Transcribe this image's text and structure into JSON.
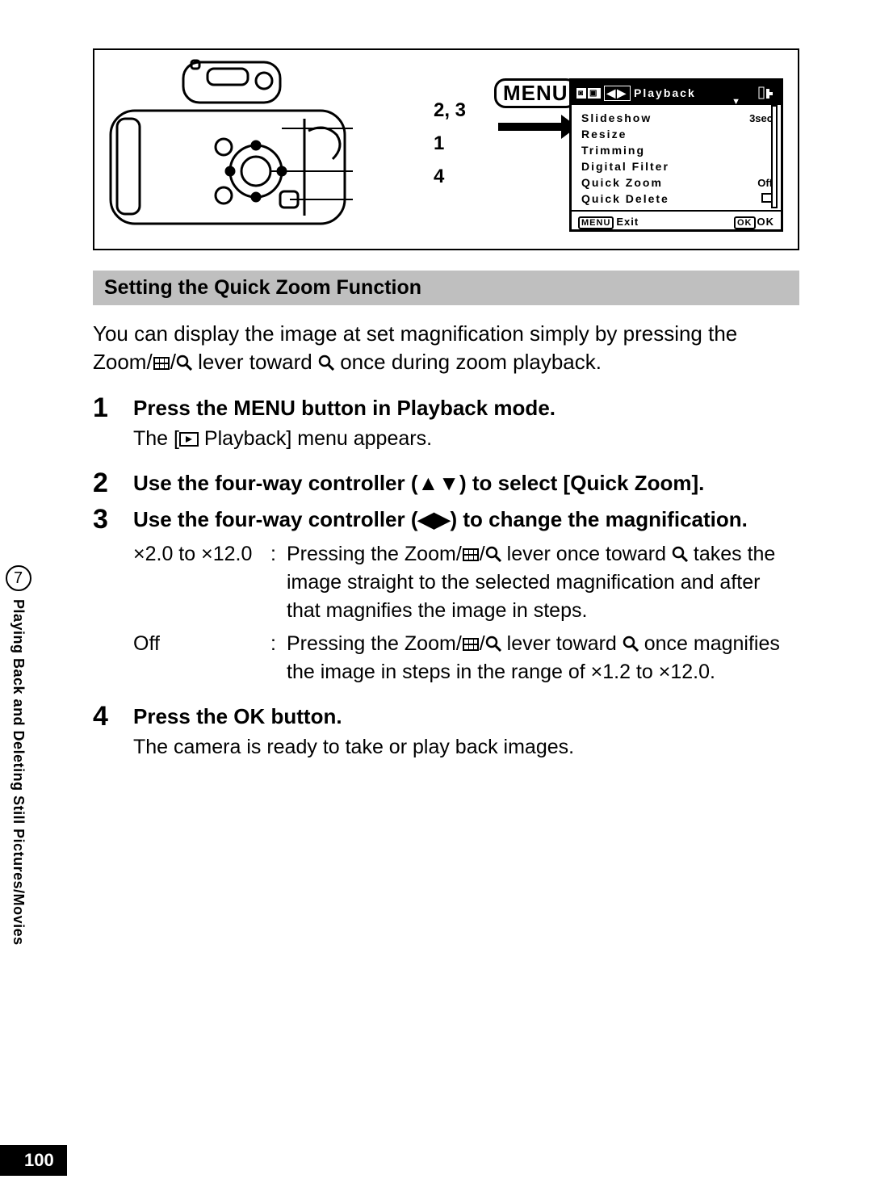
{
  "page_number": "100",
  "sidebar": {
    "chapter_num": "7",
    "chapter_title": "Playing Back and Deleting Still Pictures/Movies"
  },
  "figure": {
    "menu_button_label": "MENU",
    "callouts": {
      "line1": "2, 3",
      "line2": "1",
      "line3": "4"
    }
  },
  "lcd": {
    "title": "Playback",
    "items": [
      {
        "label": "Slideshow",
        "value": "3sec"
      },
      {
        "label": "Resize",
        "value": ""
      },
      {
        "label": "Trimming",
        "value": ""
      },
      {
        "label": "Digital Filter",
        "value": ""
      },
      {
        "label": "Quick Zoom",
        "value": "Off"
      },
      {
        "label": "Quick Delete",
        "value": "icon"
      }
    ],
    "footer_left_btn": "MENU",
    "footer_left": "Exit",
    "footer_right_btn": "OK",
    "footer_right": "OK"
  },
  "section_heading": "Setting the Quick Zoom Function",
  "intro_a": "You can display the image at set magnification simply by pressing the Zoom/",
  "intro_b": " lever toward ",
  "intro_c": " once during zoom playback.",
  "steps": {
    "s1": {
      "num": "1",
      "head": "Press the MENU button in Playback mode.",
      "sub_a": "The [",
      "sub_b": " Playback] menu appears."
    },
    "s2": {
      "num": "2",
      "head_a": "Use the four-way controller (",
      "head_b": ") to select [Quick Zoom]."
    },
    "s3": {
      "num": "3",
      "head_a": "Use the four-way controller (",
      "head_b": ") to change the magnification.",
      "def1_label": "×2.0 to ×12.0",
      "def1_a": "Pressing the Zoom/",
      "def1_b": " lever once toward ",
      "def1_c": " takes the image straight to the selected magnification and after that magnifies the image in steps.",
      "def2_label": "Off",
      "def2_a": "Pressing the Zoom/",
      "def2_b": " lever toward ",
      "def2_c": " once magnifies the image in steps in the range of ×1.2 to ×12.0."
    },
    "s4": {
      "num": "4",
      "head": "Press the OK button.",
      "sub": "The camera is ready to take or play back images."
    }
  }
}
